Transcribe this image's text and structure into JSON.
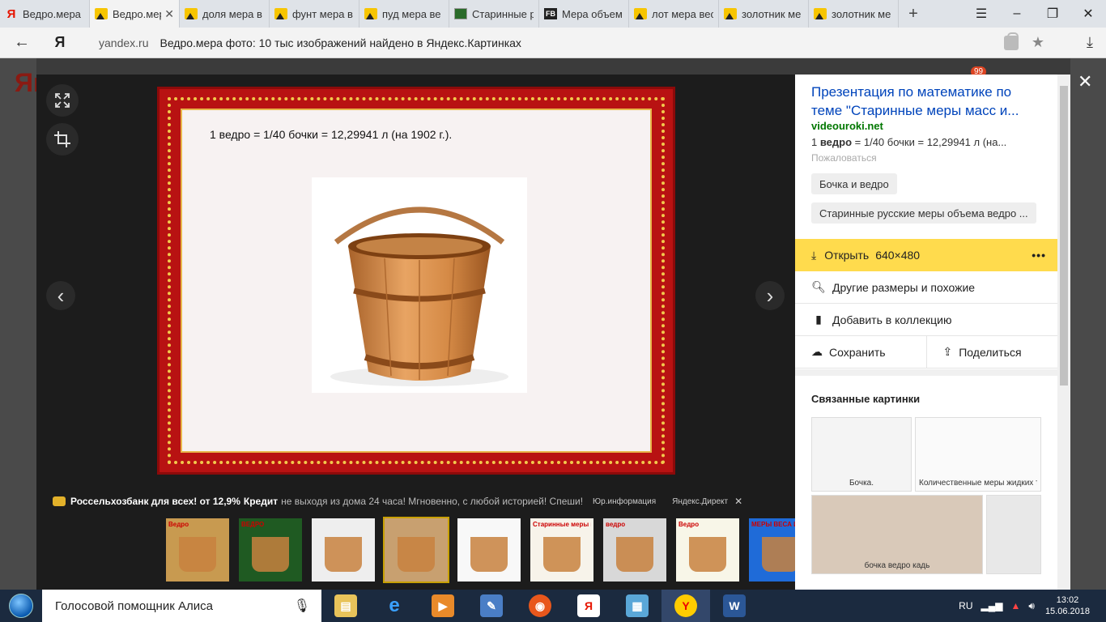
{
  "tabs": [
    {
      "label": "Ведро.мера",
      "favicon": "yandex",
      "active": false
    },
    {
      "label": "Ведро.мер",
      "favicon": "images",
      "active": true
    },
    {
      "label": "доля мера в",
      "favicon": "images",
      "active": false
    },
    {
      "label": "фунт мера в",
      "favicon": "images",
      "active": false
    },
    {
      "label": "пуд мера ве",
      "favicon": "images",
      "active": false
    },
    {
      "label": "Старинные р",
      "favicon": "green",
      "active": false
    },
    {
      "label": "Мера объем",
      "favicon": "fb",
      "active": false
    },
    {
      "label": "лот мера вес",
      "favicon": "images",
      "active": false
    },
    {
      "label": "золотник ме",
      "favicon": "images",
      "active": false
    },
    {
      "label": "золотник ме",
      "favicon": "images",
      "active": false
    }
  ],
  "address": {
    "domain": "yandex.ru",
    "title": "Ведро.мера фото: 10 тыс изображений найдено в Яндекс.Картинках",
    "logo": "Я"
  },
  "background": {
    "logo": "Ян",
    "badge": "99"
  },
  "viewer": {
    "slide_caption": "1 ведро = 1/40 бочки = 12,29941 л (на 1902 г.).",
    "ad": {
      "bank": "Россельхозбанк для всех! от 12,9%",
      "product": "Кредит",
      "text": "не выходя из дома 24 часа! Мгновенно, с любой историей! Спеши!",
      "legal": "Юр.информация",
      "source": "Яндекс.Директ"
    },
    "thumbnails": [
      {
        "label": "Ведро",
        "color": "#c89a50",
        "active": false
      },
      {
        "label": "ВЕДРО",
        "color": "#1f5a22",
        "active": false
      },
      {
        "label": "",
        "color": "#eeeeee",
        "active": false
      },
      {
        "label": "",
        "color": "#c8a070",
        "active": true
      },
      {
        "label": "",
        "color": "#f8f8f8",
        "active": false
      },
      {
        "label": "Старинные меры измерения объема ВЕДРО",
        "color": "#f7f3ea",
        "active": false
      },
      {
        "label": "ведро",
        "color": "#d8d8d8",
        "active": false
      },
      {
        "label": "Ведро",
        "color": "#f8f6e8",
        "active": false
      },
      {
        "label": "МЕРЫ ВЕСА И ОБЪЕМ",
        "color": "#1f6bd8",
        "active": false
      }
    ]
  },
  "panel": {
    "title": "Презентация по математике по теме \"Старинные меры масс и...",
    "site": "videouroki.net",
    "snippet_prefix": "1 ",
    "snippet_bold": "ведро",
    "snippet_rest": " = 1/40 бочки = 12,29941 л (на...",
    "complain": "Пожаловаться",
    "chips": [
      "Бочка и ведро",
      "Старинные русские меры объема ведро ..."
    ],
    "open_label": "Открыть",
    "open_size": "640×480",
    "more": "•••",
    "similar": "Другие размеры и похожие",
    "collection": "Добавить в коллекцию",
    "save": "Сохранить",
    "share": "Поделиться",
    "related_title": "Связанные картинки",
    "related": [
      {
        "label": "Бочка.",
        "color": "#f4f4f4"
      },
      {
        "label": "Количественные меры жидких тел",
        "color": "#fafafa"
      },
      {
        "label": "бочка   ведро   кадь",
        "color": "#d9c9b9"
      },
      {
        "label": "",
        "color": "#e8e8e8"
      }
    ]
  },
  "taskbar": {
    "search": "Голосовой помощник Алиса",
    "lang": "RU",
    "time": "13:02",
    "date": "15.06.2018"
  },
  "colors": {
    "accent": "#ffdb4d",
    "link": "#0044bb",
    "site": "#007700",
    "frame": "#b81212"
  }
}
